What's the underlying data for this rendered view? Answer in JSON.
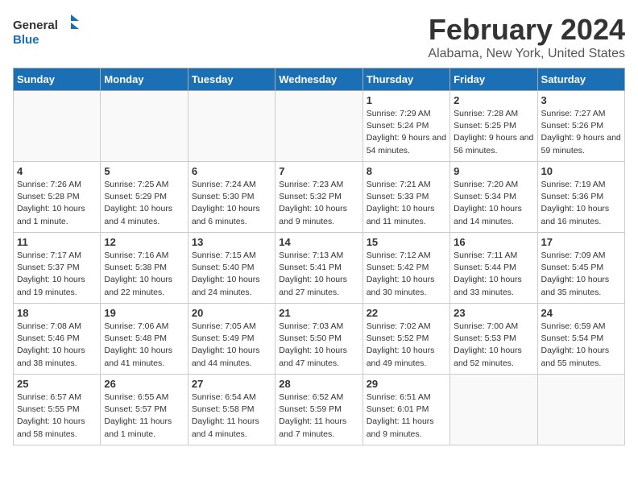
{
  "header": {
    "logo_text_general": "General",
    "logo_text_blue": "Blue",
    "month_title": "February 2024",
    "location": "Alabama, New York, United States"
  },
  "days_of_week": [
    "Sunday",
    "Monday",
    "Tuesday",
    "Wednesday",
    "Thursday",
    "Friday",
    "Saturday"
  ],
  "weeks": [
    [
      {
        "day": "",
        "empty": true
      },
      {
        "day": "",
        "empty": true
      },
      {
        "day": "",
        "empty": true
      },
      {
        "day": "",
        "empty": true
      },
      {
        "day": "1",
        "sunrise": "7:29 AM",
        "sunset": "5:24 PM",
        "daylight": "9 hours and 54 minutes."
      },
      {
        "day": "2",
        "sunrise": "7:28 AM",
        "sunset": "5:25 PM",
        "daylight": "9 hours and 56 minutes."
      },
      {
        "day": "3",
        "sunrise": "7:27 AM",
        "sunset": "5:26 PM",
        "daylight": "9 hours and 59 minutes."
      }
    ],
    [
      {
        "day": "4",
        "sunrise": "7:26 AM",
        "sunset": "5:28 PM",
        "daylight": "10 hours and 1 minute."
      },
      {
        "day": "5",
        "sunrise": "7:25 AM",
        "sunset": "5:29 PM",
        "daylight": "10 hours and 4 minutes."
      },
      {
        "day": "6",
        "sunrise": "7:24 AM",
        "sunset": "5:30 PM",
        "daylight": "10 hours and 6 minutes."
      },
      {
        "day": "7",
        "sunrise": "7:23 AM",
        "sunset": "5:32 PM",
        "daylight": "10 hours and 9 minutes."
      },
      {
        "day": "8",
        "sunrise": "7:21 AM",
        "sunset": "5:33 PM",
        "daylight": "10 hours and 11 minutes."
      },
      {
        "day": "9",
        "sunrise": "7:20 AM",
        "sunset": "5:34 PM",
        "daylight": "10 hours and 14 minutes."
      },
      {
        "day": "10",
        "sunrise": "7:19 AM",
        "sunset": "5:36 PM",
        "daylight": "10 hours and 16 minutes."
      }
    ],
    [
      {
        "day": "11",
        "sunrise": "7:17 AM",
        "sunset": "5:37 PM",
        "daylight": "10 hours and 19 minutes."
      },
      {
        "day": "12",
        "sunrise": "7:16 AM",
        "sunset": "5:38 PM",
        "daylight": "10 hours and 22 minutes."
      },
      {
        "day": "13",
        "sunrise": "7:15 AM",
        "sunset": "5:40 PM",
        "daylight": "10 hours and 24 minutes."
      },
      {
        "day": "14",
        "sunrise": "7:13 AM",
        "sunset": "5:41 PM",
        "daylight": "10 hours and 27 minutes."
      },
      {
        "day": "15",
        "sunrise": "7:12 AM",
        "sunset": "5:42 PM",
        "daylight": "10 hours and 30 minutes."
      },
      {
        "day": "16",
        "sunrise": "7:11 AM",
        "sunset": "5:44 PM",
        "daylight": "10 hours and 33 minutes."
      },
      {
        "day": "17",
        "sunrise": "7:09 AM",
        "sunset": "5:45 PM",
        "daylight": "10 hours and 35 minutes."
      }
    ],
    [
      {
        "day": "18",
        "sunrise": "7:08 AM",
        "sunset": "5:46 PM",
        "daylight": "10 hours and 38 minutes."
      },
      {
        "day": "19",
        "sunrise": "7:06 AM",
        "sunset": "5:48 PM",
        "daylight": "10 hours and 41 minutes."
      },
      {
        "day": "20",
        "sunrise": "7:05 AM",
        "sunset": "5:49 PM",
        "daylight": "10 hours and 44 minutes."
      },
      {
        "day": "21",
        "sunrise": "7:03 AM",
        "sunset": "5:50 PM",
        "daylight": "10 hours and 47 minutes."
      },
      {
        "day": "22",
        "sunrise": "7:02 AM",
        "sunset": "5:52 PM",
        "daylight": "10 hours and 49 minutes."
      },
      {
        "day": "23",
        "sunrise": "7:00 AM",
        "sunset": "5:53 PM",
        "daylight": "10 hours and 52 minutes."
      },
      {
        "day": "24",
        "sunrise": "6:59 AM",
        "sunset": "5:54 PM",
        "daylight": "10 hours and 55 minutes."
      }
    ],
    [
      {
        "day": "25",
        "sunrise": "6:57 AM",
        "sunset": "5:55 PM",
        "daylight": "10 hours and 58 minutes."
      },
      {
        "day": "26",
        "sunrise": "6:55 AM",
        "sunset": "5:57 PM",
        "daylight": "11 hours and 1 minute."
      },
      {
        "day": "27",
        "sunrise": "6:54 AM",
        "sunset": "5:58 PM",
        "daylight": "11 hours and 4 minutes."
      },
      {
        "day": "28",
        "sunrise": "6:52 AM",
        "sunset": "5:59 PM",
        "daylight": "11 hours and 7 minutes."
      },
      {
        "day": "29",
        "sunrise": "6:51 AM",
        "sunset": "6:01 PM",
        "daylight": "11 hours and 9 minutes."
      },
      {
        "day": "",
        "empty": true
      },
      {
        "day": "",
        "empty": true
      }
    ]
  ],
  "daylight_label": "Daylight:"
}
